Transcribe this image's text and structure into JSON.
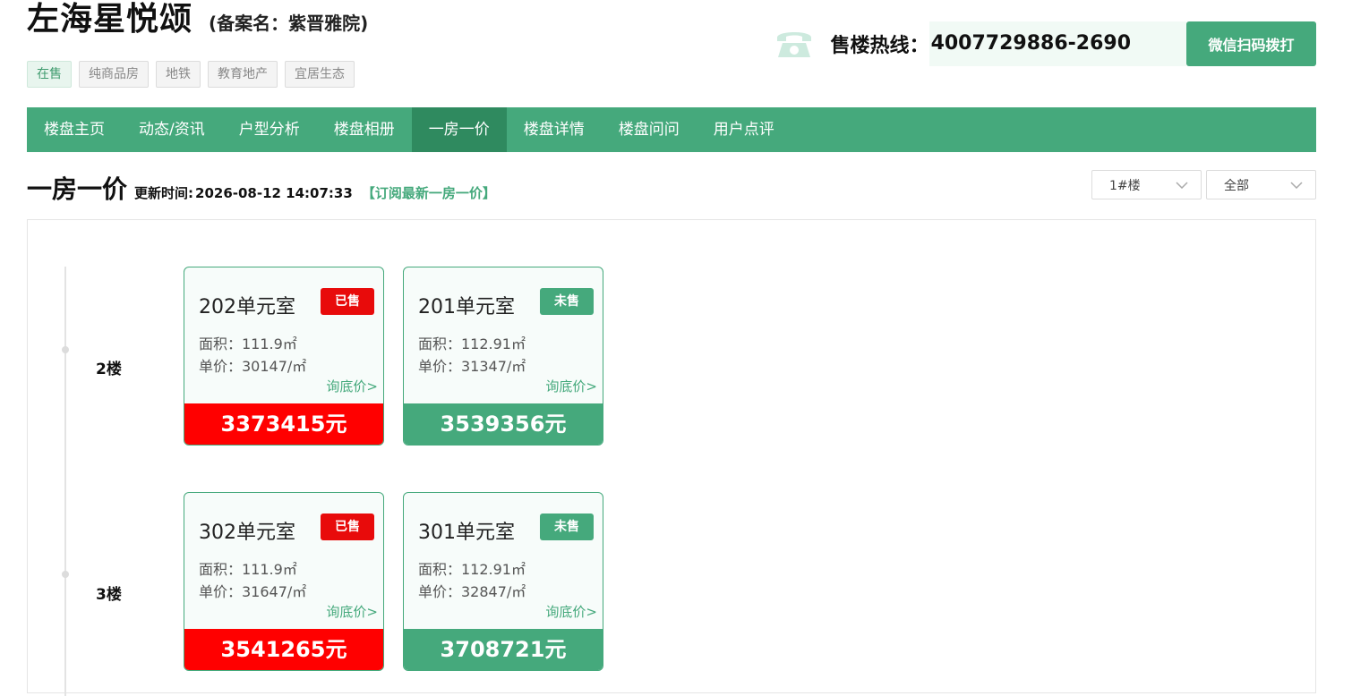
{
  "project": {
    "name": "左海星悦颂",
    "record_name": "(备案名：紫晋雅院)"
  },
  "tags": [
    "在售",
    "纯商品房",
    "地铁",
    "教育地产",
    "宜居生态"
  ],
  "hotline": {
    "label": "售楼热线：",
    "number": "4007729886-2690",
    "button": "微信扫码拨打"
  },
  "nav": {
    "items": [
      "楼盘主页",
      "动态/资讯",
      "户型分析",
      "楼盘相册",
      "一房一价",
      "楼盘详情",
      "楼盘问问",
      "用户点评"
    ],
    "active": "一房一价"
  },
  "section": {
    "title": "一房一价",
    "update_label": "更新时间:",
    "update_time": "2026-08-12 14:07:33",
    "subscribe": "【订阅最新一房一价】"
  },
  "filters": {
    "building": "1#楼",
    "status": "全部"
  },
  "floors": [
    {
      "label": "2楼",
      "units": [
        {
          "room": "202单元室",
          "status": "已售",
          "area": "面积：111.9㎡",
          "unit_price": "单价：30147/㎡",
          "ask": "询底价>",
          "total": "3373415元"
        },
        {
          "room": "201单元室",
          "status": "未售",
          "area": "面积：112.91㎡",
          "unit_price": "单价：31347/㎡",
          "ask": "询底价>",
          "total": "3539356元"
        }
      ]
    },
    {
      "label": "3楼",
      "units": [
        {
          "room": "302单元室",
          "status": "已售",
          "area": "面积：111.9㎡",
          "unit_price": "单价：31647/㎡",
          "ask": "询底价>",
          "total": "3541265元"
        },
        {
          "room": "301单元室",
          "status": "未售",
          "area": "面积：112.91㎡",
          "unit_price": "单价：32847/㎡",
          "ask": "询底价>",
          "total": "3708721元"
        }
      ]
    }
  ],
  "colors": {
    "brand_green": "#45a97c",
    "sold_red": "#ff0000"
  }
}
